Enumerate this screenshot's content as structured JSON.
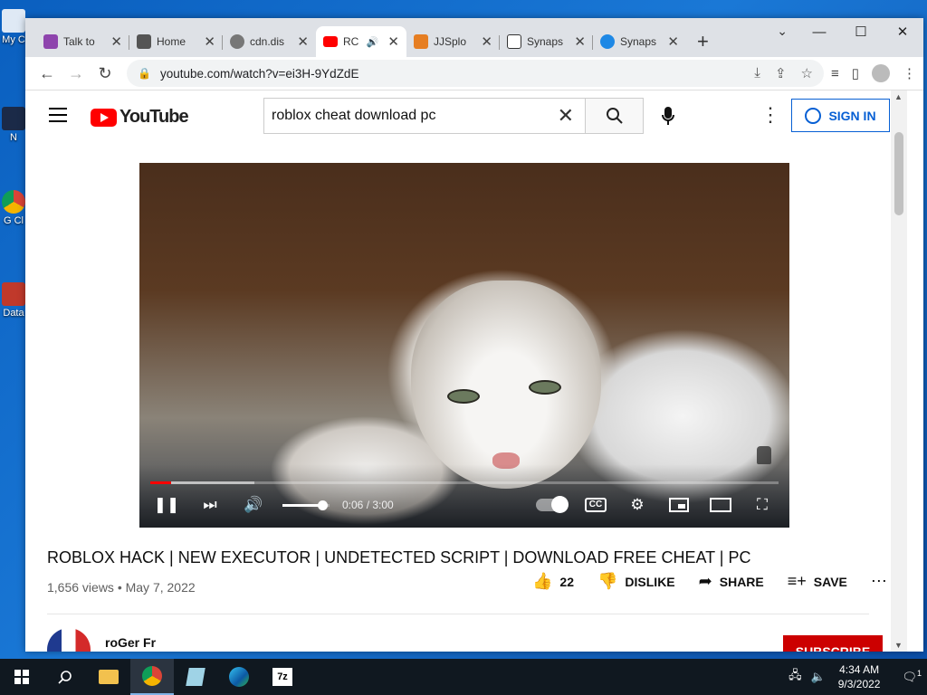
{
  "desktop": {
    "icons": [
      {
        "label": "My C"
      },
      {
        "label": "N"
      },
      {
        "label": "G Cl"
      },
      {
        "label": "Data"
      }
    ]
  },
  "browser": {
    "tabs": [
      {
        "label": "Talk to",
        "icon": "c-letter-icon",
        "color": "#8e44ad"
      },
      {
        "label": "Home",
        "icon": "home-icon",
        "color": "#555555"
      },
      {
        "label": "cdn.dis",
        "icon": "globe-icon",
        "color": "#666666"
      },
      {
        "label": "RC",
        "icon": "youtube-icon",
        "color": "#ff0000",
        "active": true
      },
      {
        "label": "JJSplo",
        "icon": "jjsploit-icon",
        "color": "#e67e22"
      },
      {
        "label": "Synaps",
        "icon": "t-letter-icon",
        "color": "#222222"
      },
      {
        "label": "Synaps",
        "icon": "synapse-icon",
        "color": "#1e88e5"
      }
    ],
    "url": "youtube.com/watch?v=ei3H-9YdZdE"
  },
  "youtube": {
    "logo_text": "YouTube",
    "search_value": "roblox cheat download pc",
    "sign_in": "SIGN IN",
    "player": {
      "current_time": "0:06",
      "duration": "3:00",
      "time_display": "0:06 / 3:00",
      "played_fraction": 0.033,
      "loaded_fraction": 0.165,
      "volume_fraction": 0.85
    },
    "video_title": "ROBLOX HACK | NEW EXECUTOR | UNDETECTED SCRIPT | DOWNLOAD FREE CHEAT | PC",
    "views": "1,656 views",
    "date": "May 7, 2022",
    "meta_line": "1,656 views • May 7, 2022",
    "likes": "22",
    "dislike": "DISLIKE",
    "share": "SHARE",
    "save": "SAVE",
    "channel_name": "roGer Fr",
    "subscribe": "SUBSCRIBE"
  },
  "taskbar": {
    "time": "4:34 AM",
    "date": "9/3/2022",
    "notifications": "1"
  }
}
